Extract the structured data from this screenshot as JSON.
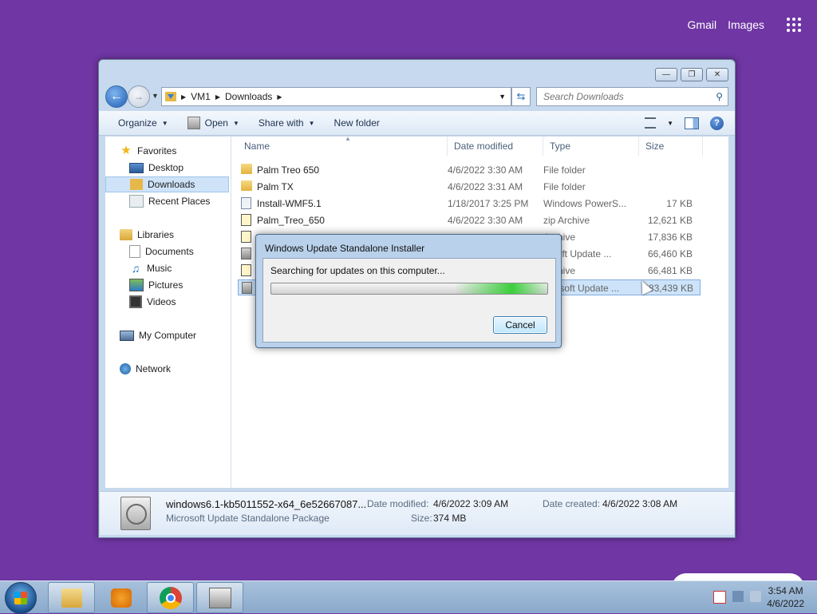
{
  "google": {
    "gmail": "Gmail",
    "images": "Images"
  },
  "explorer": {
    "breadcrumb": [
      "VM1",
      "Downloads"
    ],
    "search_placeholder": "Search Downloads",
    "toolbar": {
      "organize": "Organize",
      "open": "Open",
      "share_with": "Share with",
      "new_folder": "New folder"
    },
    "nav": {
      "favorites": "Favorites",
      "desktop": "Desktop",
      "downloads": "Downloads",
      "recent_places": "Recent Places",
      "libraries": "Libraries",
      "documents": "Documents",
      "music": "Music",
      "pictures": "Pictures",
      "videos": "Videos",
      "my_computer": "My Computer",
      "network": "Network"
    },
    "columns": {
      "name": "Name",
      "date_modified": "Date modified",
      "type": "Type",
      "size": "Size"
    },
    "files": [
      {
        "name": "Palm Treo 650",
        "date": "4/6/2022 3:30 AM",
        "type": "File folder",
        "size": "",
        "icon": "folder-icon"
      },
      {
        "name": "Palm TX",
        "date": "4/6/2022 3:31 AM",
        "type": "File folder",
        "size": "",
        "icon": "folder-icon"
      },
      {
        "name": "Install-WMF5.1",
        "date": "1/18/2017 3:25 PM",
        "type": "Windows PowerS...",
        "size": "17 KB",
        "icon": "powershell-script-icon"
      },
      {
        "name": "Palm_Treo_650",
        "date": "4/6/2022 3:30 AM",
        "type": "zip Archive",
        "size": "12,621 KB",
        "icon": "zip-icon"
      },
      {
        "name": "",
        "date": "",
        "type": "Archive",
        "size": "17,836 KB",
        "icon": "zip-icon"
      },
      {
        "name": "",
        "date": "",
        "type": "rosoft Update ...",
        "size": "66,460 KB",
        "icon": "update-package-icon"
      },
      {
        "name": "",
        "date": "",
        "type": "Archive",
        "size": "66,481 KB",
        "icon": "zip-icon"
      },
      {
        "name": "",
        "date": "",
        "type": "icrosoft Update ...",
        "size": "383,439 KB",
        "icon": "update-package-icon"
      }
    ],
    "details": {
      "filename": "windows6.1-kb5011552-x64_6e52667087...",
      "filetype": "Microsoft Update Standalone Package",
      "date_modified_label": "Date modified:",
      "date_modified": "4/6/2022 3:09 AM",
      "date_created_label": "Date created:",
      "date_created": "4/6/2022 3:08 AM",
      "size_label": "Size:",
      "size": "374 MB"
    }
  },
  "dialog": {
    "title": "Windows Update Standalone Installer",
    "message": "Searching for updates on this computer...",
    "cancel": "Cancel"
  },
  "taskbar": {
    "time": "3:54 AM",
    "date": "4/6/2022"
  }
}
